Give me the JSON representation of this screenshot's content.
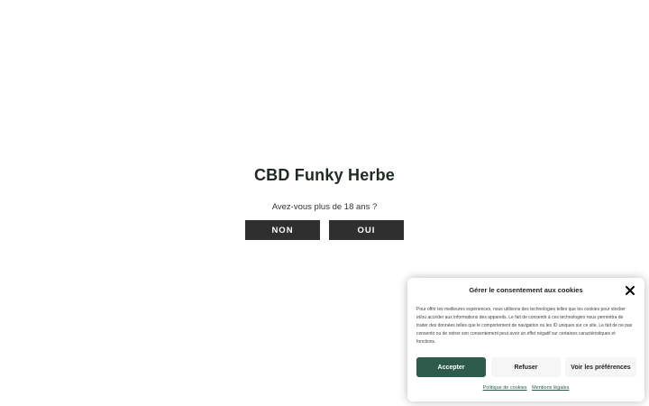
{
  "age_gate": {
    "title": "CBD Funky Herbe",
    "question": "Avez-vous plus de 18 ans ?",
    "no_label": "NON",
    "yes_label": "OUI"
  },
  "cookie_banner": {
    "title": "Gérer le consentement aux cookies",
    "close_icon": "close-icon",
    "text": "Pour offrir les meilleures expériences, nous utilisons des technologies telles que les cookies pour stocker et/ou accéder aux informations des appareils. Le fait de consentir à ces technologies nous permettra de traiter des données telles que le comportement de navigation ou les ID uniques sur ce site. Le fait de ne pas consentir ou de retirer son consentement peut avoir un effet négatif sur certaines caractéristiques et fonctions.",
    "accept_label": "Accepter",
    "refuse_label": "Refuser",
    "preferences_label": "Voir les préférences",
    "links": [
      {
        "label": "Politique de cookies"
      },
      {
        "label": "Mentions légales"
      }
    ],
    "accent_color": "#2d5a4a"
  }
}
